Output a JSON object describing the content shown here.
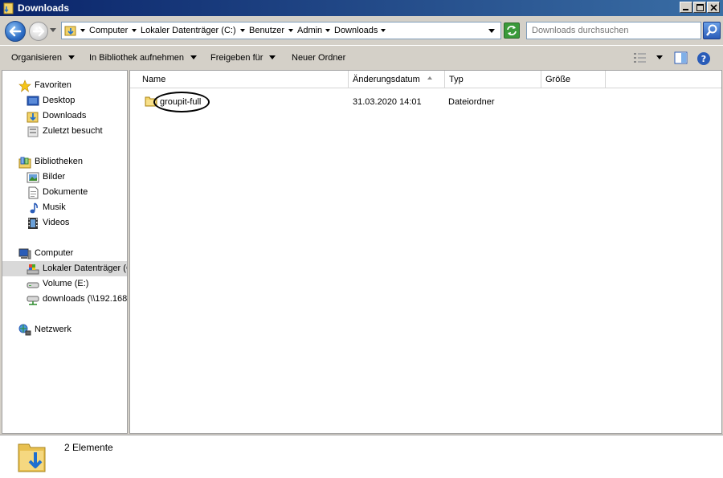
{
  "window": {
    "title": "Downloads"
  },
  "address": {
    "crumbs": [
      "Computer",
      "Lokaler Datenträger (C:)",
      "Benutzer",
      "Admin",
      "Downloads"
    ]
  },
  "search": {
    "placeholder": "Downloads durchsuchen"
  },
  "toolbar": {
    "organize": "Organisieren",
    "library": "In Bibliothek aufnehmen",
    "share": "Freigeben für",
    "new_folder": "Neuer Ordner"
  },
  "sidebar": {
    "favorites": {
      "label": "Favoriten",
      "items": [
        "Desktop",
        "Downloads",
        "Zuletzt besucht"
      ]
    },
    "libraries": {
      "label": "Bibliotheken",
      "items": [
        "Bilder",
        "Dokumente",
        "Musik",
        "Videos"
      ]
    },
    "computer": {
      "label": "Computer",
      "items": [
        "Lokaler Datenträger (C:)",
        "Volume (E:)",
        "downloads (\\\\192.168"
      ]
    },
    "network": {
      "label": "Netzwerk"
    }
  },
  "columns": [
    "Name",
    "Änderungsdatum",
    "Typ",
    "Größe"
  ],
  "files": [
    {
      "name": "groupit-full",
      "modified": "31.03.2020 14:01",
      "type": "Dateiordner",
      "size": ""
    }
  ],
  "details": {
    "count": "2 Elemente"
  }
}
